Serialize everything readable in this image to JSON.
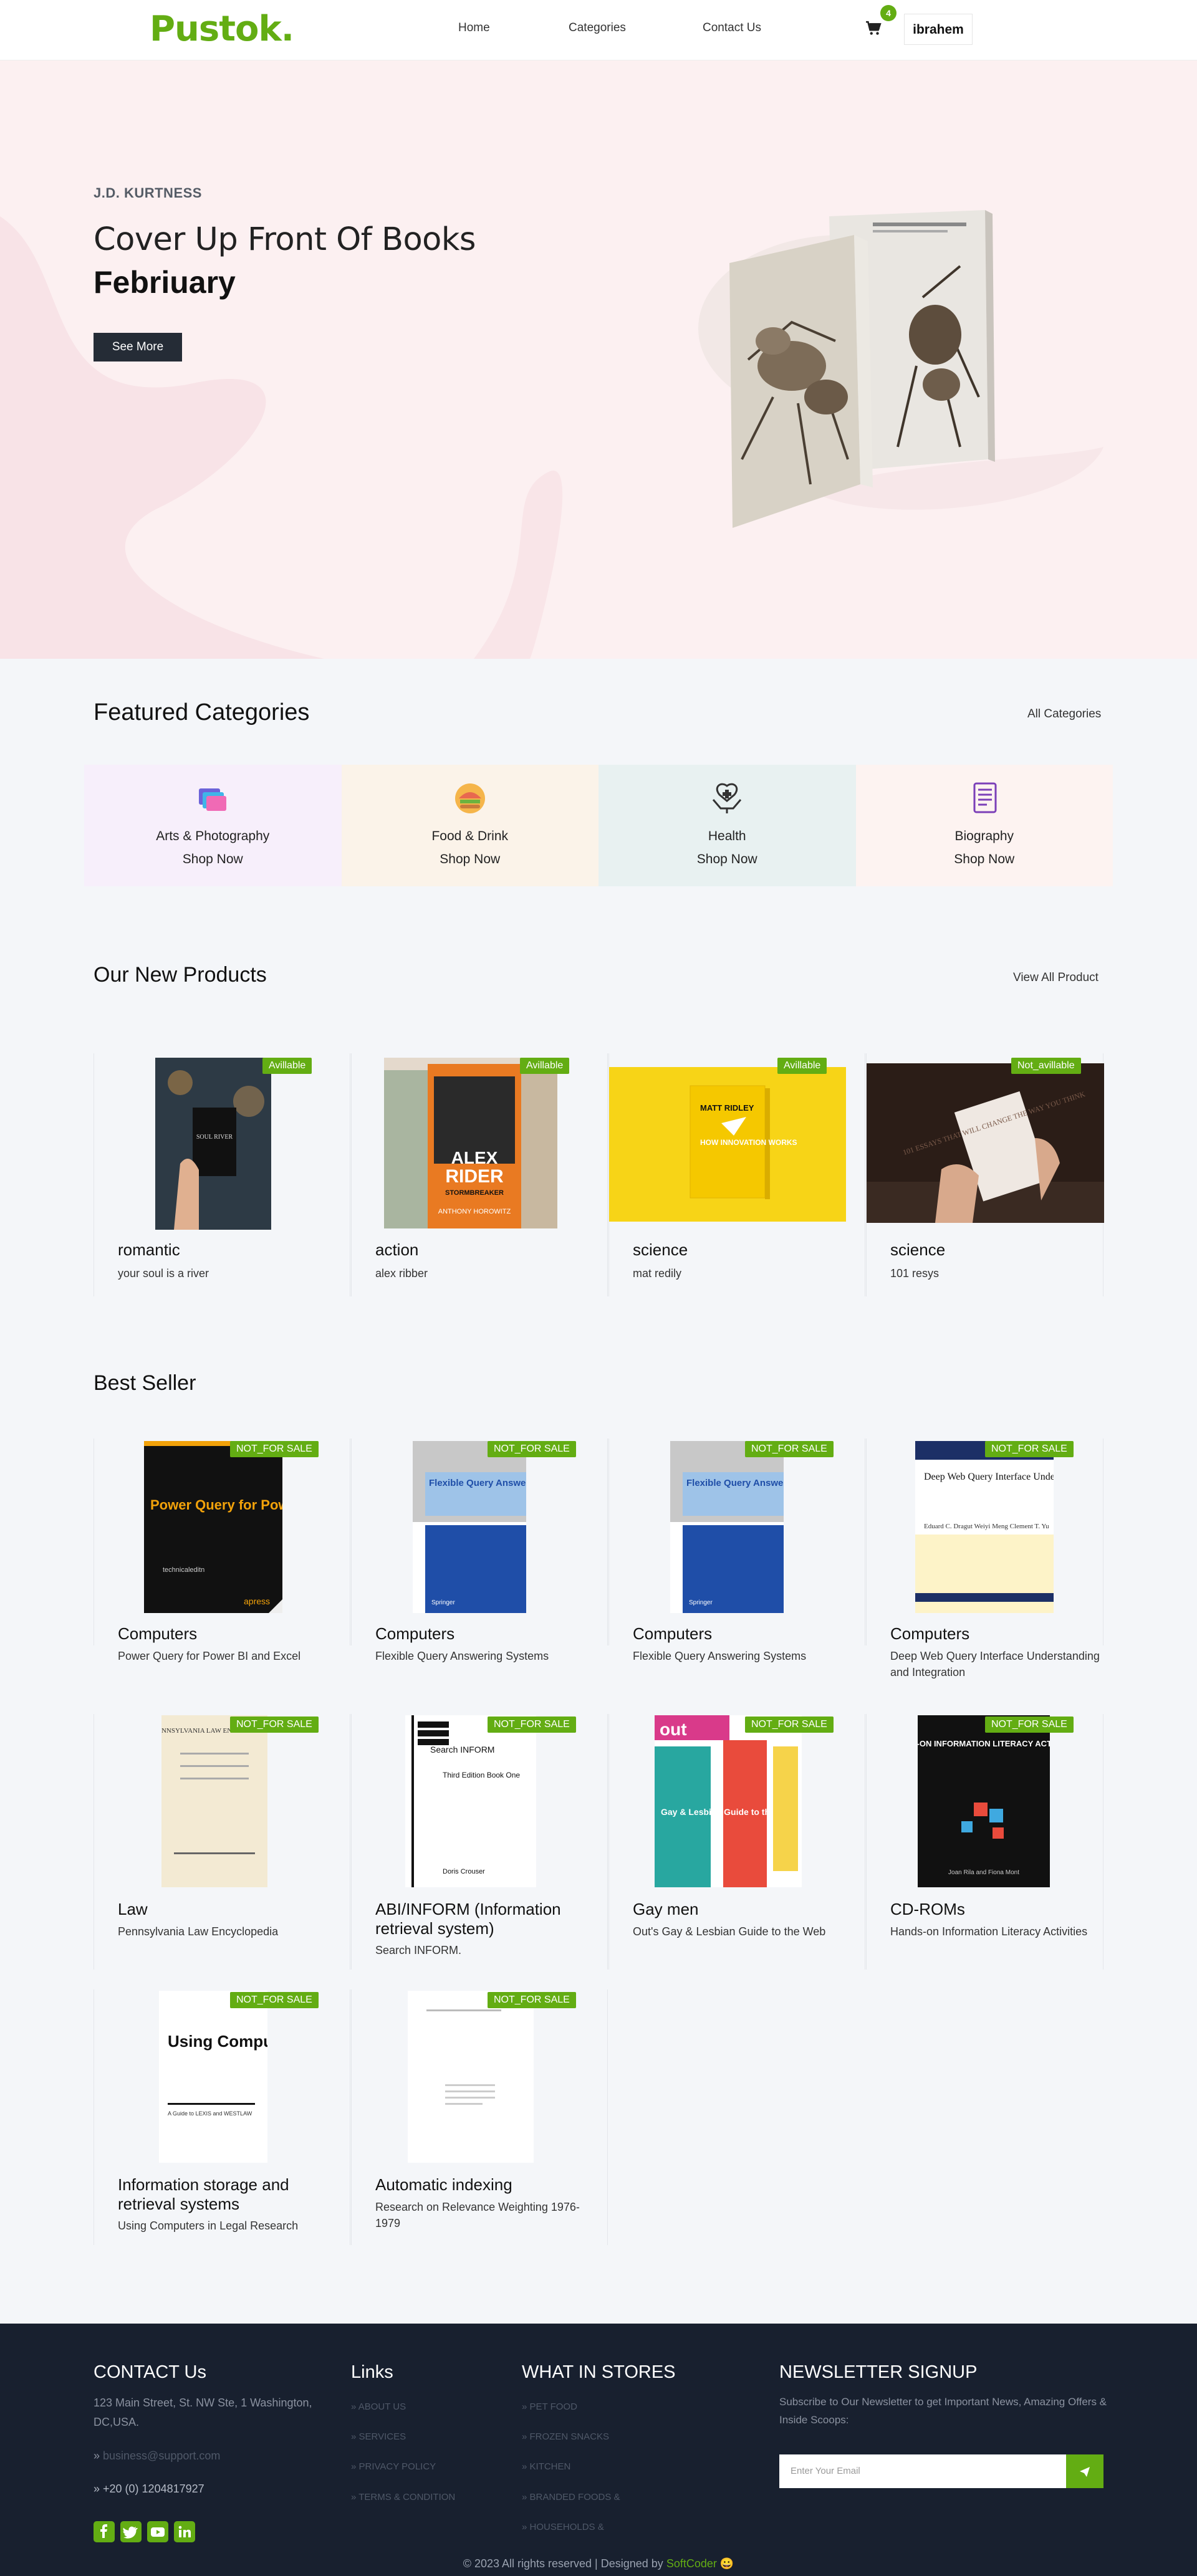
{
  "header": {
    "logo": "Pustok.",
    "nav": [
      "Home",
      "Categories",
      "Contact Us"
    ],
    "cart_count": "4",
    "user_name": "ibrahem",
    "accent_color": "#63ad13"
  },
  "hero": {
    "author": "J.D. KURTNESS",
    "title": "Cover Up Front Of Books",
    "subtitle": "Febriuary",
    "button": "See More",
    "background_color": "#fcf0f1"
  },
  "featured": {
    "title": "Featured Categories",
    "all_link": "All Categories",
    "categories": [
      {
        "name": "Arts & Photography",
        "cta": "Shop Now",
        "icon": "palette-icon",
        "bg": "#f7effb"
      },
      {
        "name": "Food & Drink",
        "cta": "Shop Now",
        "icon": "food-icon",
        "bg": "#fbf3e9"
      },
      {
        "name": "Health",
        "cta": "Shop Now",
        "icon": "health-icon",
        "bg": "#e8f1f1"
      },
      {
        "name": "Biography",
        "cta": "Shop Now",
        "icon": "book-icon",
        "bg": "#fdf3f1"
      }
    ]
  },
  "new_products": {
    "title": "Our New Products",
    "view_all": "View All Product",
    "items": [
      {
        "category": "romantic",
        "name": "your soul is a river",
        "badge": "Avillable"
      },
      {
        "category": "action",
        "name": "alex ribber",
        "badge": "Avillable"
      },
      {
        "category": "science",
        "name": "mat redily",
        "badge": "Avillable"
      },
      {
        "category": "science",
        "name": "101 resys",
        "badge": "Not_avillable"
      }
    ]
  },
  "best_seller": {
    "title": "Best Seller",
    "items": [
      {
        "category": "Computers",
        "name": "Power Query for Power BI and Excel",
        "badge": "NOT_FOR SALE"
      },
      {
        "category": "Computers",
        "name": "Flexible Query Answering Systems",
        "badge": "NOT_FOR SALE"
      },
      {
        "category": "Computers",
        "name": "Flexible Query Answering Systems",
        "badge": "NOT_FOR SALE"
      },
      {
        "category": "Computers",
        "name": "Deep Web Query Interface Understanding and Integration",
        "badge": "NOT_FOR SALE"
      },
      {
        "category": "Law",
        "name": "Pennsylvania Law Encyclopedia",
        "badge": "NOT_FOR SALE"
      },
      {
        "category": "ABI/INFORM (Information retrieval system)",
        "name": "Search INFORM.",
        "badge": "NOT_FOR SALE"
      },
      {
        "category": "Gay men",
        "name": "Out's Gay & Lesbian Guide to the Web",
        "badge": "NOT_FOR SALE"
      },
      {
        "category": "CD-ROMs",
        "name": "Hands-on Information Literacy Activities",
        "badge": "NOT_FOR SALE"
      },
      {
        "category": "Information storage and retrieval systems",
        "name": "Using Computers in Legal Research",
        "badge": "NOT_FOR SALE"
      },
      {
        "category": "Automatic indexing",
        "name": "Research on Relevance Weighting 1976-1979",
        "badge": "NOT_FOR SALE"
      }
    ]
  },
  "covers": {
    "power_query": {
      "title": "Power Query for Power BI and Excel",
      "publisher": "technicaleditn",
      "imprint": "apress"
    },
    "flexible": {
      "title": "Flexible Query Answering Systems",
      "publisher": "Springer"
    },
    "deep_web": {
      "title": "Deep Web Query Interface Understanding and Integration",
      "authors": "Eduard C. Dragut\nWeiyi Meng\nClement T. Yu"
    },
    "pennsylvania": {
      "title": "PENNSYLVANIA LAW ENCYCLOPEDIA"
    },
    "abi": {
      "brand": "Search INFORM",
      "edition": "Third Edition Book One",
      "author": "Doris Crouser"
    },
    "gay_guide": {
      "title": "Gay & Lesbian Guide to the Web",
      "mast": "out"
    },
    "hands_on": {
      "title": "HANDS-ON INFORMATION LITERACY ACTIVITIES",
      "authors": "Joan Rila and Fiona Mont"
    },
    "legal": {
      "title": "Using Computers in Legal Research",
      "subtitle": "A Guide to LEXIS and WESTLAW"
    },
    "soul": {
      "text": "SOUL RIVER"
    },
    "alex": {
      "series": "ALEX",
      "title": "RIDER",
      "sub": "STORMBREAKER",
      "author": "ANTHONY HOROWITZ"
    },
    "matt": {
      "author": "MATT RIDLEY",
      "title": "HOW INNOVATION WORKS"
    },
    "essays": {
      "text": "101 ESSAYS THAT WILL CHANGE THE WAY YOU THINK"
    }
  },
  "footer": {
    "contact_title": "CONTACT Us",
    "address": "123 Main Street, St. NW Ste, 1 Washington, DC,USA.",
    "email": "business@support.com",
    "phone": "+20 (0) 1204817927",
    "links_title": "Links",
    "links": [
      "ABOUT US",
      "SERVICES",
      "PRIVACY POLICY",
      "TERMS & CONDITION"
    ],
    "stores_title": "WHAT IN STORES",
    "stores": [
      "PET FOOD",
      "FROZEN SNACKS",
      "KITCHEN",
      "BRANDED FOODS &",
      "HOUSEHOLDS &"
    ],
    "newsletter_title": "NEWSLETTER SIGNUP",
    "newsletter_text": "Subscribe to Our Newsletter to get Important News, Amazing Offers & Inside Scoops:",
    "email_placeholder": "Enter Your Email",
    "social": [
      "facebook-icon",
      "twitter-icon",
      "youtube-icon",
      "linkedin-icon"
    ],
    "copyright_prefix": "© 2023 All rights reserved | Designed by",
    "designer": "SoftCoder"
  }
}
